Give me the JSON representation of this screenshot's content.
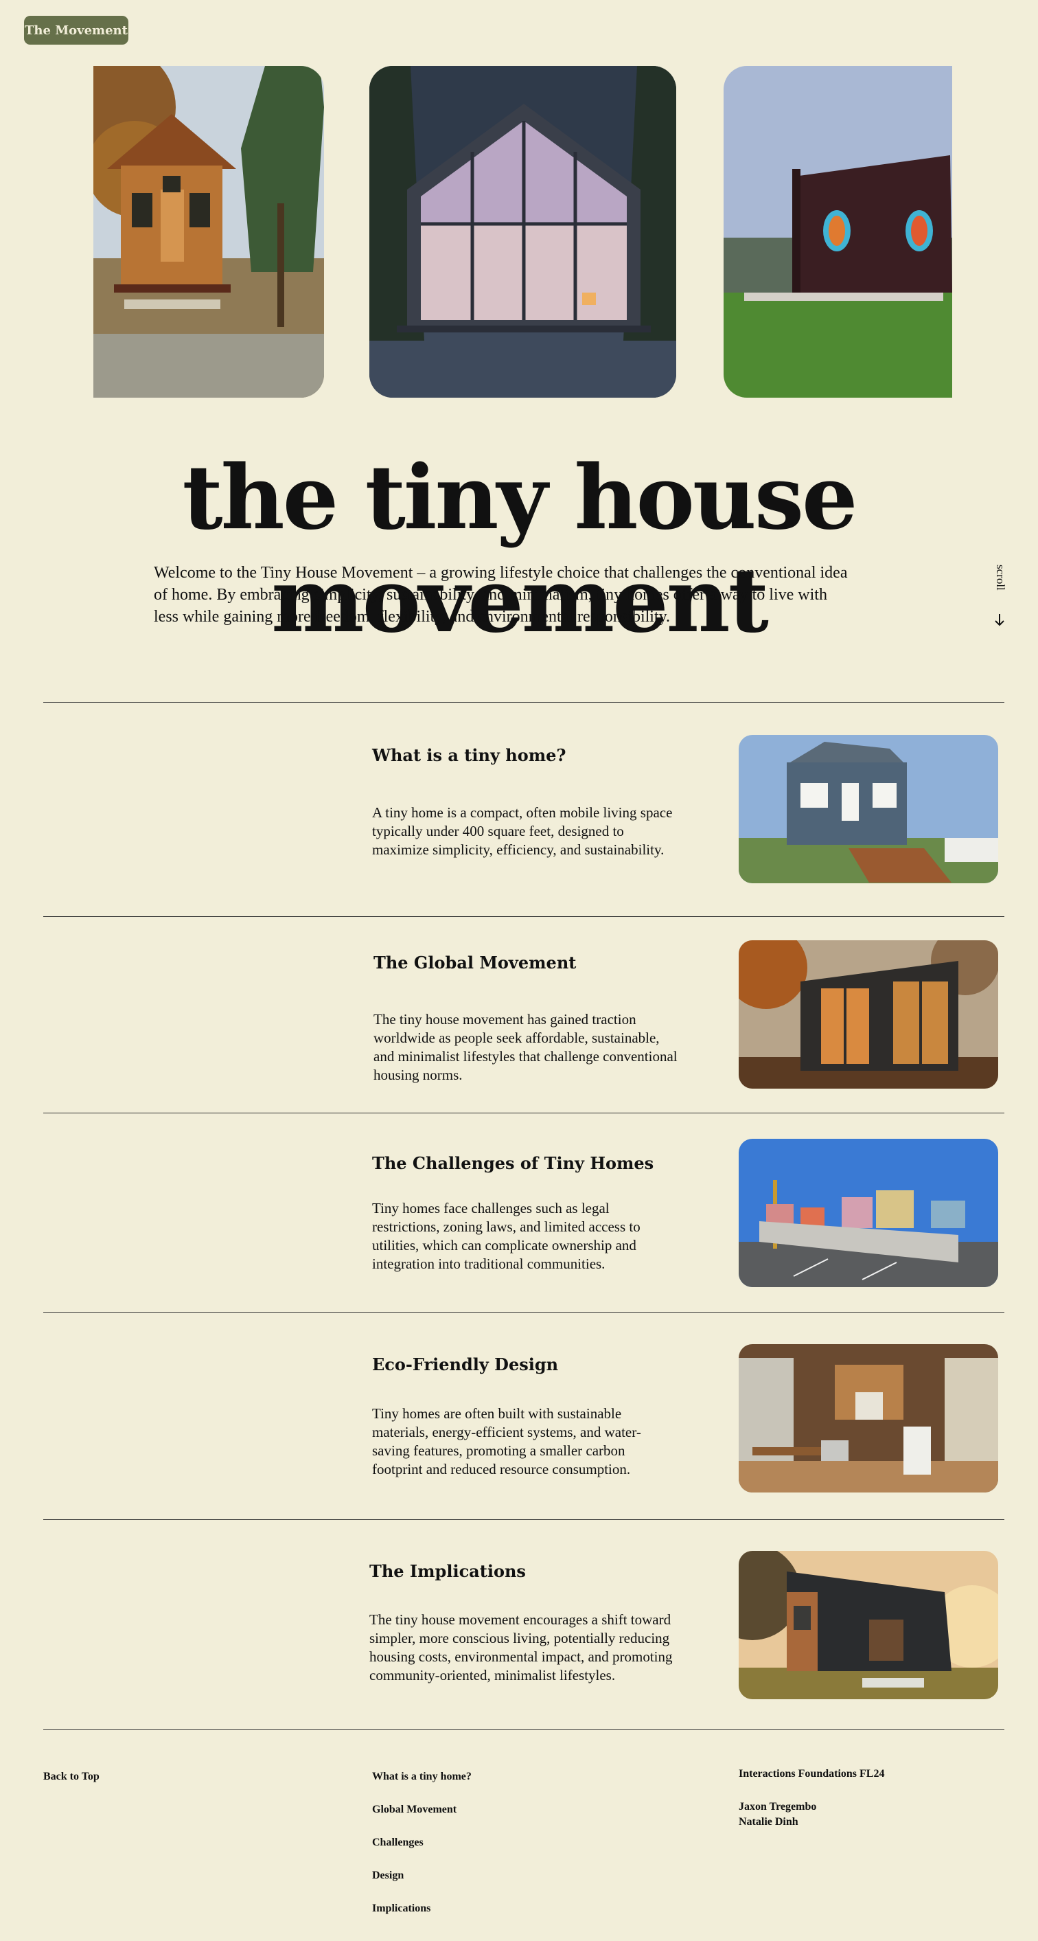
{
  "nav": {
    "badge_label": "The Movement"
  },
  "hero": {
    "images": [
      {
        "icon": "wooden-tiny-house-photo"
      },
      {
        "icon": "glass-a-frame-cabin-photo"
      },
      {
        "icon": "dark-cube-house-photo"
      }
    ],
    "title": "the tiny house movement",
    "intro_lines": [
      "Welcome to the Tiny House Movement – a growing lifestyle choice that challenges the conventional idea",
      "of home. By embracing simplicity, sustainability, and minimalism, tiny homes offer a way to live with",
      "less while gaining more freedom, flexibility, and environmental responsibility."
    ],
    "scroll_label": "scroll",
    "scroll_icon": "arrow-down-icon"
  },
  "sections": [
    {
      "title": "What is a tiny home?",
      "body_lines": [
        "A tiny home is a compact, often mobile living space",
        "typically under 400 square feet, designed to",
        "maximize simplicity, efficiency, and sustainability."
      ]
    },
    {
      "title": "The Global Movement",
      "body_lines": [
        "The tiny house movement has gained traction",
        "worldwide as people seek affordable, sustainable,",
        "and minimalist lifestyles that challenge conventional",
        "housing norms."
      ]
    },
    {
      "title": "The Challenges of Tiny Homes",
      "body_lines": [
        "Tiny homes face challenges such as legal",
        "restrictions, zoning laws, and limited access to",
        "utilities, which can complicate ownership and",
        "integration into traditional communities."
      ]
    },
    {
      "title": "Eco-Friendly Design",
      "body_lines": [
        "Tiny homes are often built with sustainable",
        "materials, energy-efficient systems, and water-",
        "saving features, promoting a smaller carbon",
        "footprint and reduced resource consumption."
      ]
    },
    {
      "title": "The Implications",
      "body_lines": [
        "The tiny house movement encourages a shift toward",
        "simpler, more conscious living, potentially reducing",
        "housing costs, environmental impact, and promoting",
        "community-oriented, minimalist lifestyles."
      ]
    }
  ],
  "footer": {
    "back_to_top": "Back to Top",
    "links": [
      "What is a tiny home?",
      "Global Movement",
      "Challenges",
      "Design",
      "Implications"
    ],
    "course": "Interactions Foundations FL24",
    "authors": [
      "Jaxon Tregembo",
      "Natalie Dinh"
    ]
  },
  "colors": {
    "background": "#f2eed9",
    "badge": "#66704a",
    "text": "#111111"
  }
}
